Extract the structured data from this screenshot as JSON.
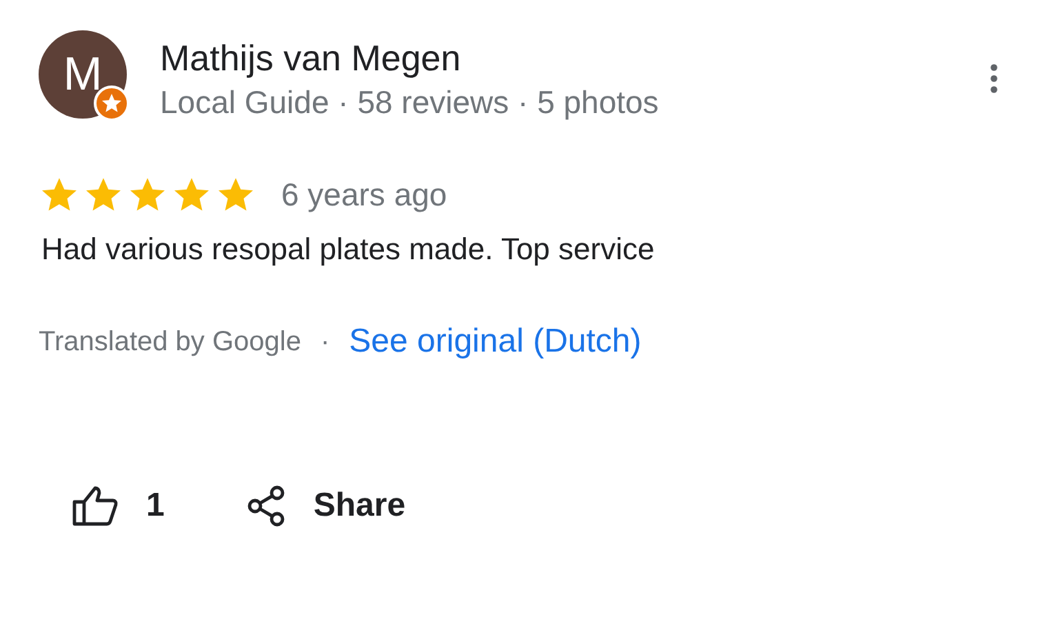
{
  "review": {
    "author": {
      "initial": "M",
      "name": "Mathijs van Megen",
      "local_guide": true,
      "details": "Local Guide · 58 reviews · 5 photos"
    },
    "stars": 5,
    "time": "6 years ago",
    "text": "Had various resopal plates made. Top service",
    "translation": {
      "label": "Translated by Google",
      "separator": "·",
      "link": "See original (Dutch)"
    },
    "actions": [
      {
        "kind": "like",
        "label": "1"
      },
      {
        "kind": "share",
        "label": "Share"
      }
    ]
  }
}
